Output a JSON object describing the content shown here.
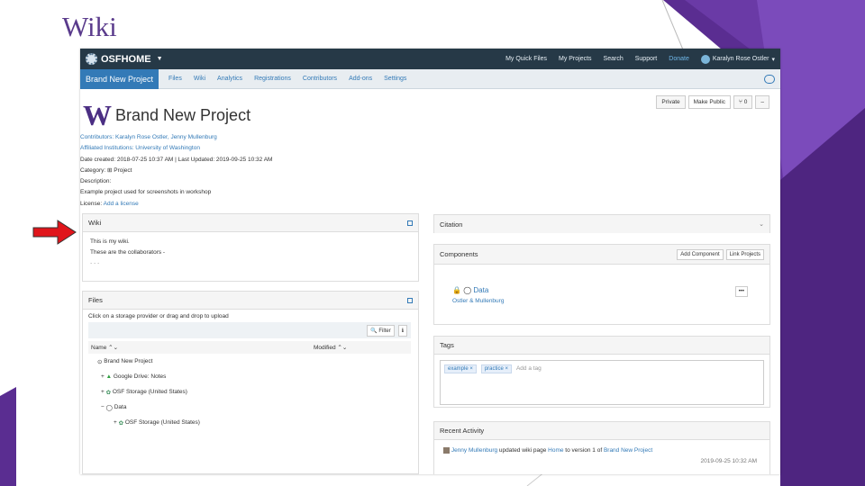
{
  "slide": {
    "title": "Wiki"
  },
  "app": {
    "brand": "OSFHOME",
    "nav": {
      "items": [
        "My Quick Files",
        "My Projects",
        "Search",
        "Support",
        "Donate"
      ],
      "user": "Karalyn Rose Ostler"
    }
  },
  "subnav": {
    "project": "Brand New Project",
    "items": [
      "Files",
      "Wiki",
      "Analytics",
      "Registrations",
      "Contributors",
      "Add-ons",
      "Settings"
    ]
  },
  "header": {
    "privacy": "Private",
    "make_public": "Make Public",
    "fork_count": "0",
    "menu_icon": "–"
  },
  "project": {
    "title": "Brand New Project",
    "logo_letter": "W",
    "contributors_label": "Contributors:",
    "contributors": "Karalyn Rose Ostler, Jenny Mullenburg",
    "affiliated": "Affiliated Institutions: University of Washington",
    "date_created": "Date created: 2018-07-25 10:37 AM | Last Updated: 2019-09-25 10:32 AM",
    "category": "Category: ⊞ Project",
    "description_label": "Description:",
    "description": "Example project used for screenshots in workshop",
    "license_label": "License:",
    "license": "Add a license"
  },
  "wiki": {
    "heading": "Wiki",
    "lines": [
      "This is my wiki.",
      "These are the collaborators -",
      "· · ·"
    ]
  },
  "files": {
    "heading": "Files",
    "hint": "Click on a storage provider or drag and drop to upload",
    "filter": "Filter",
    "col_name": "Name",
    "col_modified": "Modified",
    "rows": [
      {
        "toggle": "",
        "icon": "⊙",
        "label": "Brand New Project"
      },
      {
        "toggle": "+",
        "icon": "▲",
        "label": "Google Drive: Notes"
      },
      {
        "toggle": "+",
        "icon": "✿",
        "label": "OSF Storage (United States)"
      },
      {
        "toggle": "−",
        "icon": "◯",
        "label": "Data"
      },
      {
        "toggle": "+",
        "icon": "✿",
        "label": "OSF Storage (United States)"
      }
    ]
  },
  "citation": {
    "heading": "Citation"
  },
  "components": {
    "heading": "Components",
    "add": "Add Component",
    "link": "Link Projects",
    "item": "Data",
    "item_authors": "Ostler & Mullenburg",
    "item_menu": "•••"
  },
  "tags": {
    "heading": "Tags",
    "items": [
      "example ×",
      "practice ×"
    ],
    "placeholder": "Add a tag"
  },
  "activity": {
    "heading": "Recent Activity",
    "user": "Jenny Mullenburg",
    "text": " updated wiki page ",
    "page": "Home",
    "text2": " to version 1 of ",
    "project": "Brand New Project",
    "time": "2019-09-25 10:32 AM"
  },
  "colors": {
    "slide_purple": "#5a2d91",
    "nav_bg": "#263947",
    "link": "#337ab7",
    "arrow_red": "#e0151b"
  }
}
